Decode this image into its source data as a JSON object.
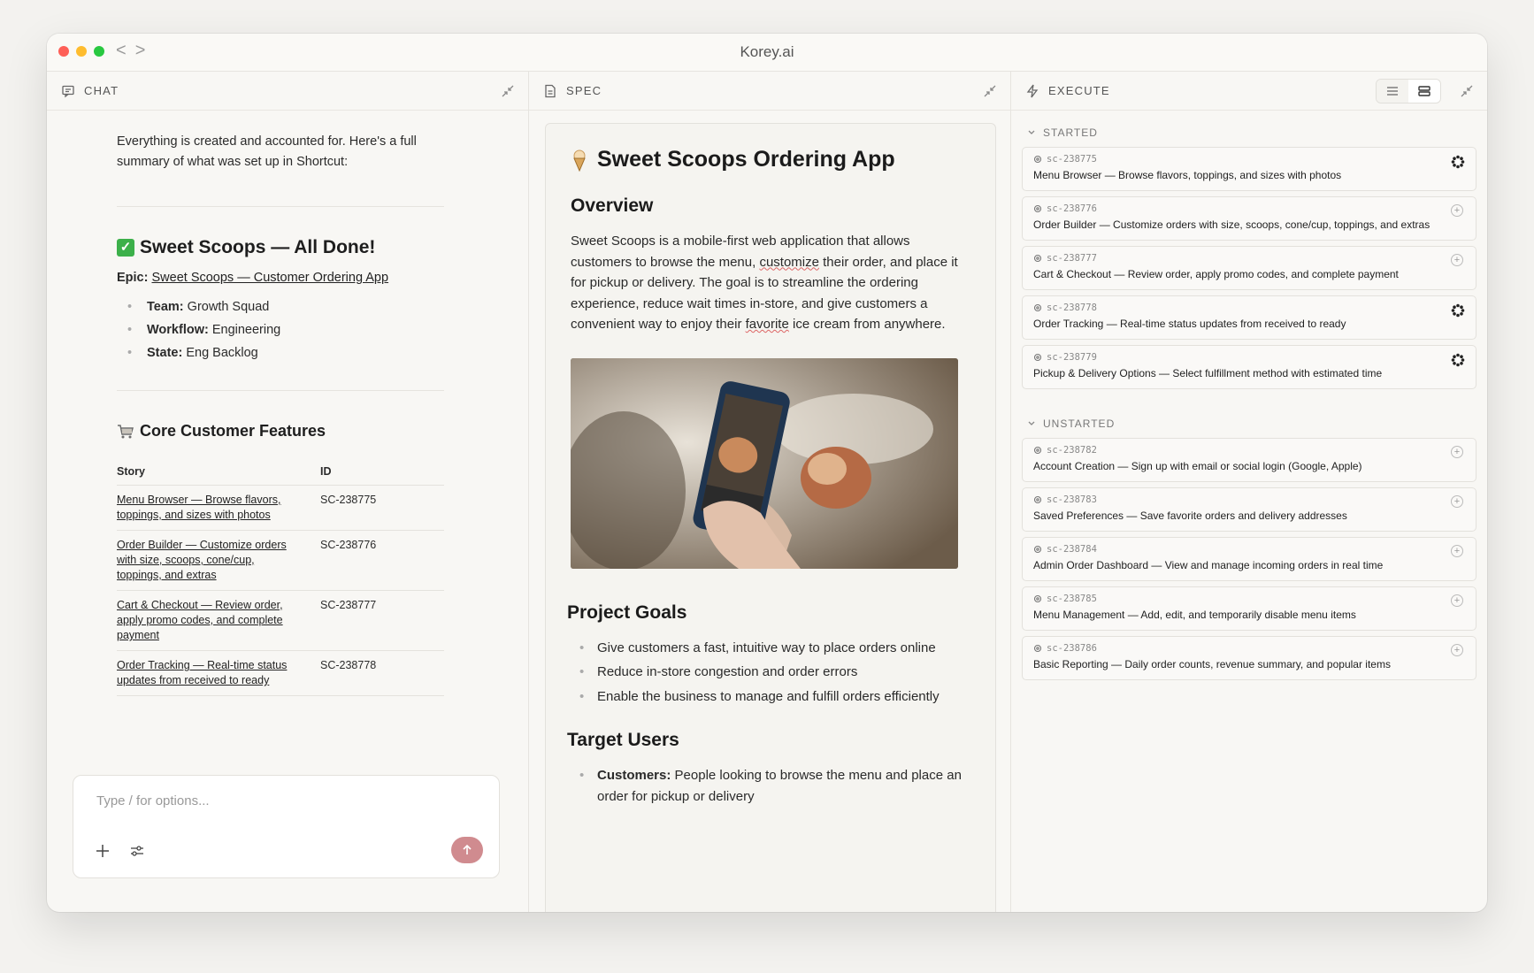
{
  "app": {
    "title": "Korey.ai"
  },
  "chat": {
    "header": "CHAT",
    "intro": "Everything is created and accounted for. Here's a full summary of what was set up in Shortcut:",
    "done_heading": "Sweet Scoops — All Done!",
    "epic_label": "Epic:",
    "epic_link": "Sweet Scoops — Customer Ordering App",
    "meta": [
      {
        "label": "Team:",
        "value": "Growth Squad"
      },
      {
        "label": "Workflow:",
        "value": "Engineering"
      },
      {
        "label": "State:",
        "value": "Eng Backlog"
      }
    ],
    "features_heading": "Core Customer Features",
    "table": {
      "headers": [
        "Story",
        "ID"
      ],
      "rows": [
        {
          "story": "Menu Browser — Browse flavors, toppings, and sizes with photos",
          "id": "SC-238775"
        },
        {
          "story": "Order Builder — Customize orders with size, scoops, cone/cup, toppings, and extras",
          "id": "SC-238776"
        },
        {
          "story": "Cart & Checkout — Review order, apply promo codes, and complete payment",
          "id": "SC-238777"
        },
        {
          "story": "Order Tracking — Real-time status updates from received to ready",
          "id": "SC-238778"
        }
      ]
    },
    "composer_placeholder": "Type / for options..."
  },
  "spec": {
    "header": "SPEC",
    "title": "Sweet Scoops Ordering App",
    "overview_heading": "Overview",
    "overview_parts": [
      "Sweet Scoops is a mobile-first web application that allows customers to browse the menu, ",
      "customize",
      " their order, and place it for pickup or delivery. The goal is to streamline the ordering experience, reduce wait times in-store, and give customers a convenient way to enjoy their ",
      "favorite",
      " ice cream from anywhere."
    ],
    "goals_heading": "Project Goals",
    "goals": [
      "Give customers a fast, intuitive way to place orders online",
      "Reduce in-store congestion and order errors",
      "Enable the business to manage and fulfill orders efficiently"
    ],
    "users_heading": "Target Users",
    "users": [
      {
        "label": "Customers:",
        "text": "People looking to browse the menu and place an order for pickup or delivery"
      }
    ]
  },
  "execute": {
    "header": "EXECUTE",
    "started_label": "STARTED",
    "unstarted_label": "UNSTARTED",
    "started": [
      {
        "id": "sc-238775",
        "title": "Menu Browser — Browse flavors, toppings, and sizes with photos",
        "status": "in-progress"
      },
      {
        "id": "sc-238776",
        "title": "Order Builder — Customize orders with size, scoops, cone/cup, toppings, and extras",
        "status": "add"
      },
      {
        "id": "sc-238777",
        "title": "Cart & Checkout — Review order, apply promo codes, and complete payment",
        "status": "add"
      },
      {
        "id": "sc-238778",
        "title": "Order Tracking — Real-time status updates from received to ready",
        "status": "in-progress"
      },
      {
        "id": "sc-238779",
        "title": "Pickup & Delivery Options — Select fulfillment method with estimated time",
        "status": "in-progress"
      }
    ],
    "unstarted": [
      {
        "id": "sc-238782",
        "title": "Account Creation — Sign up with email or social login (Google, Apple)",
        "status": "add"
      },
      {
        "id": "sc-238783",
        "title": "Saved Preferences — Save favorite orders and delivery addresses",
        "status": "add"
      },
      {
        "id": "sc-238784",
        "title": "Admin Order Dashboard — View and manage incoming orders in real time",
        "status": "add"
      },
      {
        "id": "sc-238785",
        "title": "Menu Management — Add, edit, and temporarily disable menu items",
        "status": "add"
      },
      {
        "id": "sc-238786",
        "title": "Basic Reporting — Daily order counts, revenue summary, and popular items",
        "status": "add"
      }
    ]
  }
}
